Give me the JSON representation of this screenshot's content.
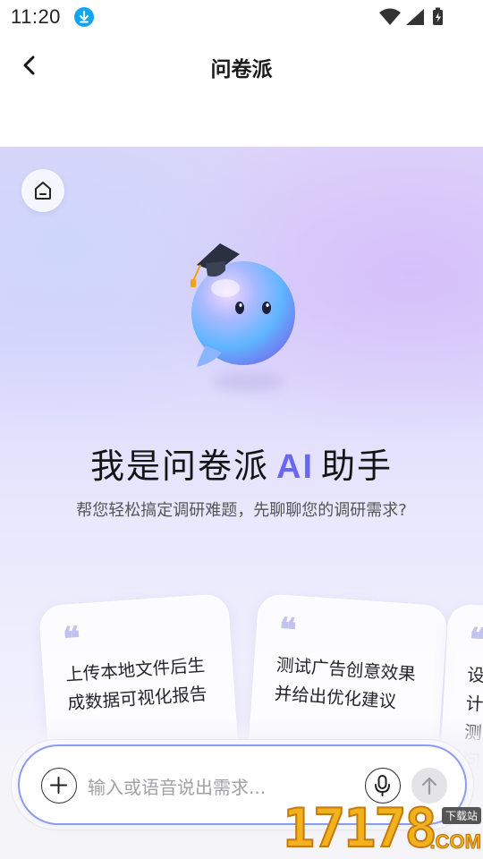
{
  "status_bar": {
    "time": "11:20",
    "download_icon": "download-icon",
    "wifi_icon": "wifi-icon",
    "signal_icon": "signal-icon",
    "battery_icon": "battery-charging-icon"
  },
  "header": {
    "title": "问卷派",
    "back_icon": "chevron-left-icon"
  },
  "main": {
    "home_icon": "home-icon",
    "title_prefix": "我是问卷派",
    "title_ai": "AI",
    "title_suffix": "助手",
    "subtitle": "帮您轻松搞定调研难题，先聊聊您的调研需求?"
  },
  "cards": [
    {
      "quote": "❝",
      "text": "上传本地文件后生成数据可视化报告"
    },
    {
      "quote": "❝",
      "text": "测试广告创意效果并给出优化建议"
    },
    {
      "quote": "❝",
      "text": "设计测问"
    }
  ],
  "input": {
    "placeholder": "输入或语音说出需求...",
    "plus_icon": "plus-icon",
    "mic_icon": "microphone-icon",
    "send_icon": "arrow-up-icon"
  },
  "watermark": {
    "digits": "17178",
    "tag": "下载站",
    "suffix": ".COM"
  },
  "colors": {
    "accent": "#6a68f2",
    "input_border": "#8f9bf2",
    "status_download": "#12a6f0"
  }
}
